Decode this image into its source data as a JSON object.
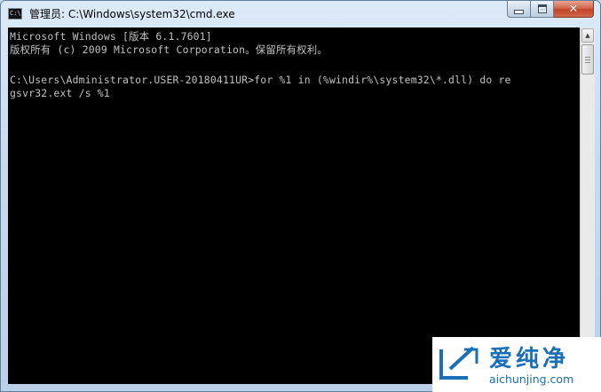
{
  "window": {
    "title": "管理员: C:\\Windows\\system32\\cmd.exe",
    "app_icon_text": "C:\\",
    "controls": {
      "minimize": "minimize",
      "maximize": "maximize",
      "close": "✕"
    }
  },
  "console": {
    "lines": [
      "Microsoft Windows [版本 6.1.7601]",
      "版权所有 (c) 2009 Microsoft Corporation。保留所有权利。",
      "",
      "C:\\Users\\Administrator.USER-20180411UR>for %1 in (%windir%\\system32\\*.dll) do re",
      "gsvr32.ext /s %1"
    ],
    "text_color": "#c0c0c0",
    "background": "#000000"
  },
  "scrollbar": {
    "up_arrow": "▲"
  },
  "watermark": {
    "brand_cn": "爱纯净",
    "url": "aichunjing.com",
    "color": "#1a6fb8"
  }
}
